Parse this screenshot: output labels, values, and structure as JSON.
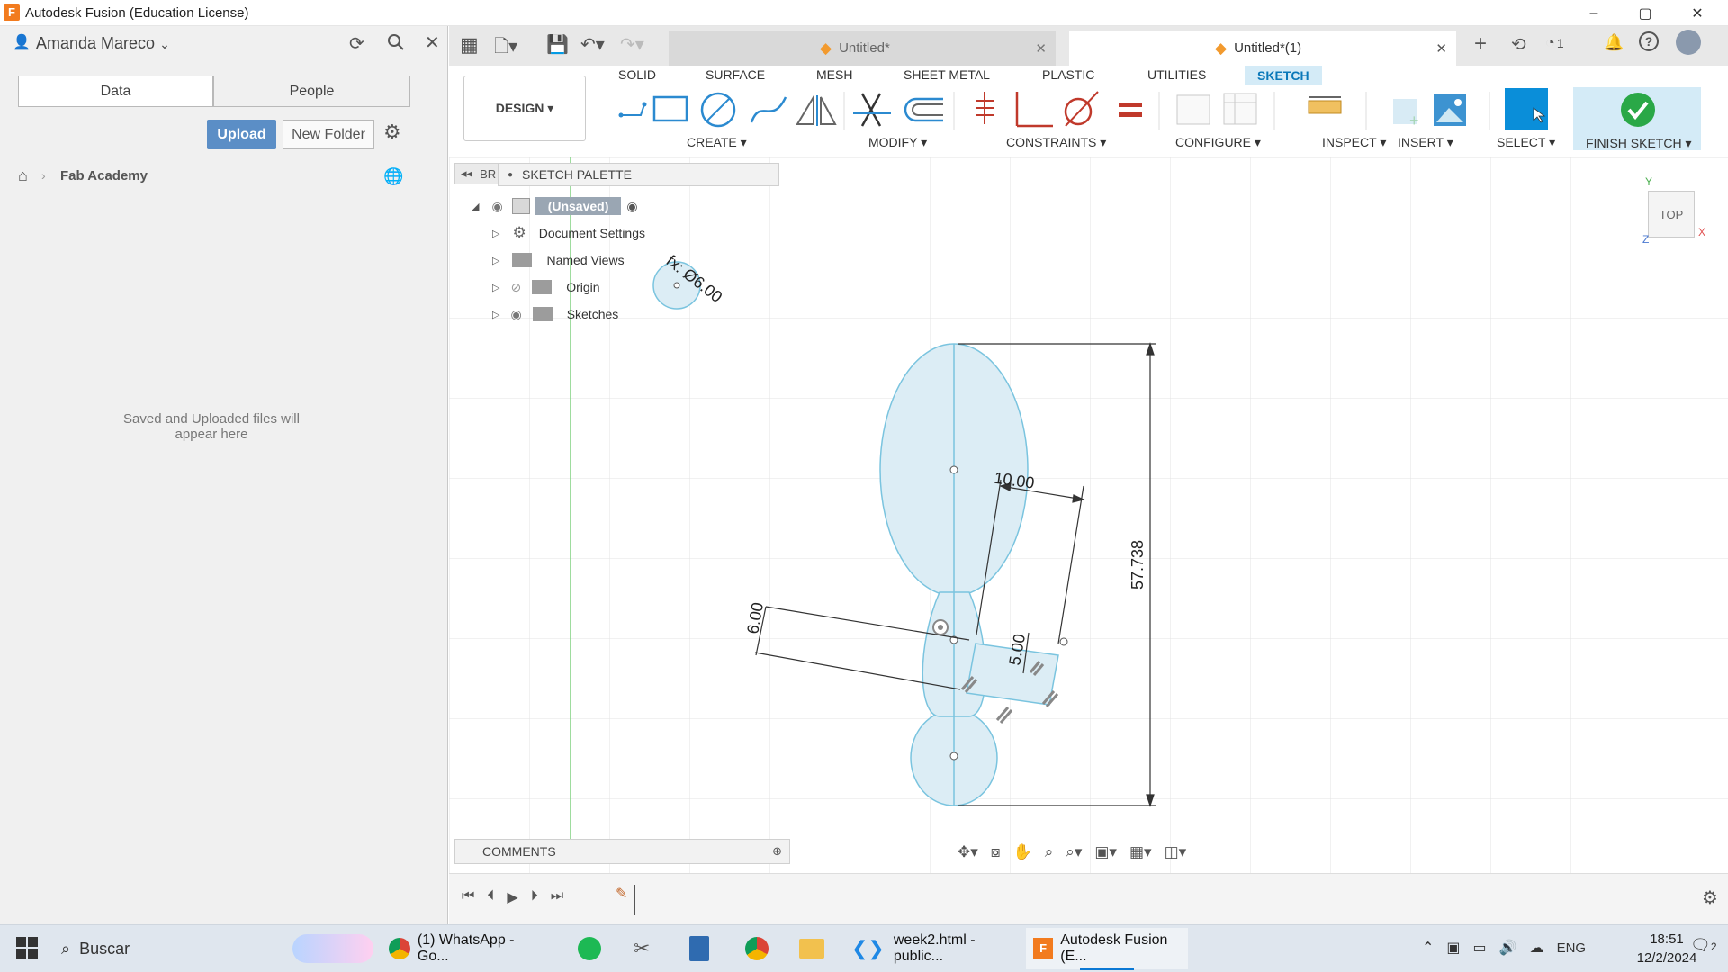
{
  "window": {
    "title": "Autodesk Fusion (Education License)",
    "min": "–",
    "max": "▢",
    "close": "✕"
  },
  "user": {
    "name": "Amanda Mareco"
  },
  "leftpanel": {
    "tab_data": "Data",
    "tab_people": "People",
    "upload": "Upload",
    "new_folder": "New Folder",
    "breadcrumb": "Fab Academy",
    "empty_line1": "Saved and Uploaded files will",
    "empty_line2": "appear here"
  },
  "tabs": [
    {
      "label": "Untitled*"
    },
    {
      "label": "Untitled*(1)"
    }
  ],
  "tabbar": {
    "jobs_count": "1"
  },
  "ribbon": {
    "design": "DESIGN ▾",
    "tabs": [
      "SOLID",
      "SURFACE",
      "MESH",
      "SHEET METAL",
      "PLASTIC",
      "UTILITIES",
      "SKETCH"
    ],
    "groups": [
      "CREATE ▾",
      "MODIFY ▾",
      "CONSTRAINTS ▾",
      "CONFIGURE ▾",
      "INSPECT ▾",
      "INSERT ▾",
      "SELECT ▾",
      "FINISH SKETCH ▾"
    ]
  },
  "browser": {
    "collapsed_label": "BR",
    "root": "(Unsaved)",
    "items": [
      "Document Settings",
      "Named Views",
      "Origin",
      "Sketches"
    ]
  },
  "palette": {
    "title": "SKETCH PALETTE"
  },
  "comments": {
    "label": "COMMENTS"
  },
  "sketch": {
    "dim_10": "10.00",
    "dim_57": "57.738",
    "dim_6": "6.00",
    "dim_5": "5.00",
    "dim_fx": "fx: Ø6.00"
  },
  "viewcube": {
    "face": "TOP",
    "axis_x": "X",
    "axis_y": "Y",
    "axis_z": "Z"
  },
  "taskbar": {
    "search": "Buscar",
    "apps": [
      "(1) WhatsApp - Go...",
      "week2.html - public...",
      "Autodesk Fusion (E..."
    ],
    "lang": "ENG",
    "time": "18:51",
    "date": "12/2/2024",
    "notif": "2"
  },
  "colors": {
    "accent": "#0696d7",
    "sketch_blue": "#cfe8f3",
    "sketch_line": "#7ac4df",
    "finish": "#2aa847"
  }
}
